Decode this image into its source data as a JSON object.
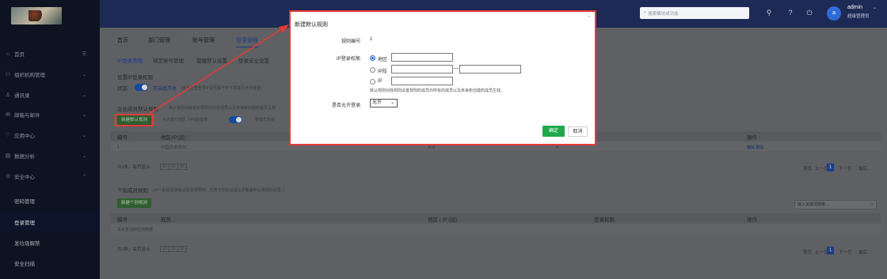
{
  "header": {
    "search_placeholder": "搜索模块或功能",
    "user_initial": "a",
    "username": "admin",
    "user_role": "超级管理员",
    "caret": "⌄"
  },
  "sidebar": {
    "items": [
      {
        "label": "首页",
        "icon": "home-icon",
        "glyph": "⌂",
        "chev": "☰"
      },
      {
        "label": "组织机构管理",
        "icon": "org-icon",
        "glyph": "⚇",
        "chev": "⌄"
      },
      {
        "label": "通讯录",
        "icon": "contacts-icon",
        "glyph": "♙",
        "chev": "⌄"
      },
      {
        "label": "邮箱与邮件",
        "icon": "mail-icon",
        "glyph": "✉",
        "chev": "⌄"
      },
      {
        "label": "应用中心",
        "icon": "app-icon",
        "glyph": "♡",
        "chev": "⌄"
      },
      {
        "label": "数据分析",
        "icon": "chart-icon",
        "glyph": "▤",
        "chev": "⌄"
      },
      {
        "label": "安全中心",
        "icon": "shield-icon",
        "glyph": "⊙",
        "chev": "⌃"
      }
    ],
    "sub_items": [
      "密码管理",
      "登录管理",
      "发垃圾解禁",
      "安全扫描"
    ]
  },
  "tabs": [
    "首页",
    "部门管理",
    "账号管理",
    "登录管理"
  ],
  "subtabs": [
    "IP登录管理",
    "绑定账号管理",
    "提醒默认设置",
    "登录安全设置"
  ],
  "ip_settings": {
    "title": "设置IP登录权限",
    "status_label": "状态:",
    "status_link": "开启此开关",
    "status_hint": "(用于检查登录IP是否属于IP下再进行允许登录)"
  },
  "default_rules": {
    "title": "企业成员默认规则",
    "hint": "默认规则对除规定规则外所有成员以及未来新创建的成员生效",
    "add_button": "新建默认规则",
    "allow_text": "允许其它地区 / IP(段)登录",
    "smart_match": "智能优先级",
    "columns": [
      "编号",
      "地区/IP(段)",
      "操作"
    ],
    "row": {
      "id": "1",
      "region": "中国(所有省市)",
      "mid1": "允许",
      "mid2": "1",
      "actions": "编辑 删除"
    }
  },
  "pager1": {
    "summary": "共1条，每页显示",
    "sizes": [
      "10",
      "20",
      "50"
    ],
    "first": "首页",
    "prev": "上一页",
    "current": "1",
    "next": "下一页",
    "last": "最后"
  },
  "member_rules": {
    "title": "个别成员规则",
    "hint": "(对个别成员单独设置登录限制，生效于您的设置会更覆盖默认规则的设置。)",
    "add_button": "新建个别规则",
    "keyword_placeholder": "输入关键词搜索...",
    "columns": [
      "编号",
      "成员",
      "地区 / IP (段)",
      "登录权限",
      "操作"
    ],
    "empty": "没有查询到任何数据"
  },
  "pager2": {
    "summary": "共0条，每页显示",
    "sizes": [
      "10",
      "20",
      "50"
    ],
    "first": "首页",
    "prev": "上一页",
    "current": "1",
    "next": "下一页",
    "last": "最后"
  },
  "modal": {
    "title": "新建默认规则",
    "close": "×",
    "rule_no_label": "规则编号:",
    "rule_no": "1",
    "ip_perm_label": "IP登录权限:",
    "opt_region": "地区",
    "opt_ip_range": "IP段",
    "opt_ip": "IP",
    "range_dash": "—",
    "note": "默认规则对除规则设置规则的成员外所有的成员以及未来新创建的成员生效。",
    "allow_label": "是否允许登录:",
    "allow_value": "允许",
    "ok": "确定",
    "cancel": "取消"
  },
  "colors": {
    "annotation_red": "#e53935",
    "ok_green": "#1fa84a",
    "accent_blue": "#1e5fd2"
  }
}
